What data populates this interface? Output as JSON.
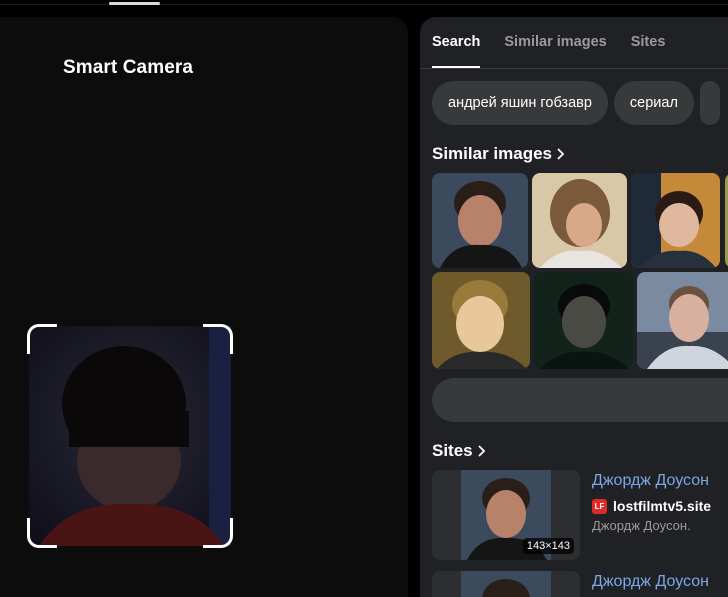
{
  "left": {
    "title": "Smart Camera"
  },
  "tabs": [
    {
      "label": "Search",
      "active": true
    },
    {
      "label": "Similar images",
      "active": false
    },
    {
      "label": "Sites",
      "active": false
    }
  ],
  "chips": [
    "андрей яшин гобзавр",
    "сериал"
  ],
  "similar": {
    "heading": "Similar images"
  },
  "sites": {
    "heading": "Sites",
    "results": [
      {
        "title": "Джордж Доусон",
        "domain": "lostfilmtv5.site",
        "favicon": "LF",
        "description": "Джордж Доусон.",
        "image_size": "143×143"
      },
      {
        "title": "Джордж Доусон"
      }
    ]
  },
  "colors": {
    "accent_link": "#7aa8e8",
    "panel": "#202124",
    "chip": "#38393b",
    "favicon": "#e02a2a"
  }
}
